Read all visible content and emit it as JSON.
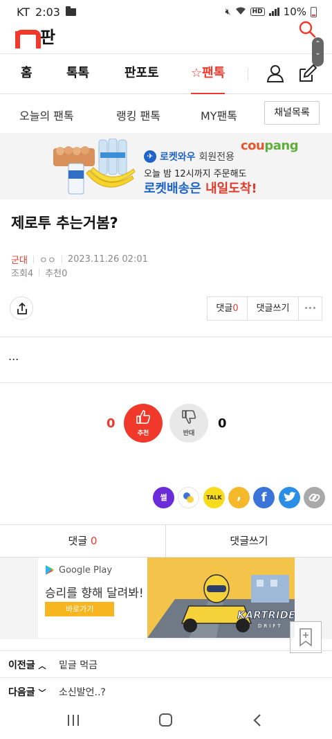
{
  "status_bar": {
    "carrier": "KT",
    "time": "2:03",
    "hd": "HD",
    "battery": "10%"
  },
  "header": {
    "logo_text": "판"
  },
  "main_nav": {
    "tabs": [
      "홈",
      "톡톡",
      "판포토",
      "☆팬톡"
    ],
    "active": "☆팬톡"
  },
  "sub_nav": {
    "items": [
      "오늘의 팬톡",
      "랭킹 팬톡",
      "MY팬톡"
    ],
    "channel_button": "채널목록"
  },
  "ad_top": {
    "brand_a": "cou",
    "brand_b": "pang",
    "rocket_label": "로켓와우",
    "member_label": "회원전용",
    "line1": "오늘 밤 12시까지 주문해도",
    "line2_a": "로켓배송은 ",
    "line2_b": "내일도착!"
  },
  "post": {
    "title": "제로투 추는거봄?",
    "author": "군대",
    "nick": "ㅇㅇ",
    "datetime": "2023.11.26 02:01",
    "views_label": "조회",
    "views": "4",
    "recommend_label": "추천",
    "recommend": "0",
    "body": "..."
  },
  "actions": {
    "comment_label": "댓글",
    "comment_count": "0",
    "write_comment": "댓글쓰기",
    "more": "•••"
  },
  "vote": {
    "up_count": "0",
    "up_label": "추천",
    "down_count": "0",
    "down_label": "반대"
  },
  "share": {
    "items": [
      {
        "name": "ssul",
        "label": "썰",
        "color": "#6b2bd9"
      },
      {
        "name": "band",
        "label": "",
        "color": "#ffffff"
      },
      {
        "name": "kakaotalk",
        "label": "TALK",
        "color": "#f6dc1c"
      },
      {
        "name": "kakaostory",
        "label": ",",
        "color": "#f4b92a"
      },
      {
        "name": "facebook",
        "label": "f",
        "color": "#3b74d9"
      },
      {
        "name": "twitter",
        "label": "",
        "color": "#2b8ee6"
      },
      {
        "name": "link",
        "label": "",
        "color": "#a9a9a9"
      }
    ]
  },
  "comment_bar": {
    "comment_label": "댓글",
    "comment_count": "0",
    "write_label": "댓글쓰기"
  },
  "ad_bottom": {
    "store": "Google Play",
    "headline": "승리를 향해 달려봐!",
    "button": "바로가기",
    "game_logo": "KARTRIDER",
    "game_sub": "DRIFT"
  },
  "prev_post": {
    "label": "이전글",
    "title": "밑글 먹금"
  },
  "next_post": {
    "label": "다음글",
    "title": "소신발언..?"
  }
}
